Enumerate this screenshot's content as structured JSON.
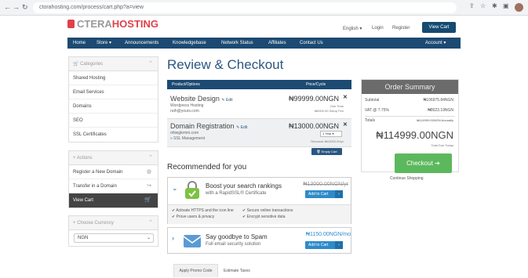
{
  "browser": {
    "url": "ctorahosting.com/process/cart.php?a=view",
    "nav_icons": [
      "back-icon",
      "forward-icon",
      "reload-icon"
    ],
    "toolbar_icons": [
      "share-icon",
      "star-icon",
      "extensions-icon",
      "sidebar-icon"
    ]
  },
  "header": {
    "logo_part1": "CTERA",
    "logo_part2": "HOSTING",
    "language": "English",
    "login": "Login",
    "register": "Register",
    "view_cart": "View Cart"
  },
  "nav": {
    "items": [
      "Home",
      "Store",
      "Announcements",
      "Knowledgebase",
      "Network Status",
      "Affiliates",
      "Contact Us"
    ],
    "account": "Account"
  },
  "sidebar": {
    "categories": {
      "title": "Categories",
      "items": [
        "Shared Hosting",
        "Email Services",
        "Domains",
        "SEO",
        "SSL Certificates"
      ]
    },
    "actions": {
      "title": "Actions",
      "items": [
        "Register a New Domain",
        "Transfer in a Domain",
        "View Cart"
      ]
    },
    "currency": {
      "title": "Choose Currency",
      "selected": "NGN"
    }
  },
  "main": {
    "title": "Review & Checkout",
    "col_product": "Product/Options",
    "col_price": "Price/Cycle",
    "items": [
      {
        "name": "Website Design",
        "edit": "Edit",
        "sub1": "Wordpress Hosting",
        "sub2": "ruth@yours.com",
        "price": "₦99999.00NGN",
        "cycle": "One Time",
        "setup": "₦0000.00 Setup Fee"
      },
      {
        "name": "Domain Registration",
        "edit": "Edit",
        "sub1": "ohiwglemm.com",
        "sub2": "» SSL Management",
        "price": "₦13000.00NGN",
        "cycle": "1 Year",
        "renew": "Renewal: ₦13000.00/yr"
      }
    ],
    "empty_cart": "Empty Cart",
    "recommended_title": "Recommended for you",
    "recommendations": [
      {
        "headline": "Boost your search rankings",
        "sub": "with a RapidSSL® Certificate",
        "price": "₦13000.00NGN/yr",
        "add": "Add to Cart",
        "features": [
          "Activate HTTPS and the icon line",
          "Secure online transactions",
          "Prove users & privacy",
          "Encrypt sensitive data"
        ]
      },
      {
        "headline": "Say goodbye to Spam",
        "sub": "Full email security solution",
        "price": "₦1150.00NGN/mo",
        "add": "Add to Cart"
      }
    ]
  },
  "summary": {
    "title": "Order Summary",
    "subtotal_label": "Subtotal",
    "subtotal_value": "₦106975.84NGN",
    "vat_label": "VAT @ 7.75%",
    "vat_value": "₦8023.19NGN",
    "totals_label": "Totals",
    "totals_value": "₦114999.00NGN Annually",
    "total": "₦114999.00NGN",
    "total_due": "Total Due Today",
    "checkout": "Checkout",
    "continue": "Continue Shopping"
  },
  "bottom": {
    "tab_promo": "Apply Promo Code",
    "tab_estimate": "Estimate Taxes"
  },
  "colors": {
    "nav_bg": "#1c4a72",
    "brand_red": "#e0404a",
    "checkout_green": "#5cb85c",
    "add_cart_blue": "#2e8bc9"
  }
}
